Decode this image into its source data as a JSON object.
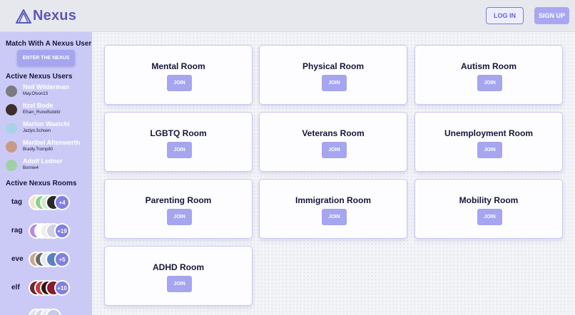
{
  "header": {
    "logo_text": "Nexus",
    "login_label": "LOG IN",
    "signup_label": "SIGN UP"
  },
  "sidebar": {
    "match_heading": "Match With A Nexus User",
    "enter_label": "ENTER THE NEXUS",
    "users_heading": "Active Nexus Users",
    "users": [
      {
        "name": "Neil Wilderman",
        "username": "May.Olson13",
        "avatar_color": "#7a7a80"
      },
      {
        "name": "Itzel Bode",
        "username": "Efrain_Runolfsdottir",
        "avatar_color": "#3e2e2a"
      },
      {
        "name": "Marlon Waelchi",
        "username": "Jazlyn.Schoen",
        "avatar_color": "#a9d2e6"
      },
      {
        "name": "Maribel Altenwerth",
        "username": "Bradly.Tromp80",
        "avatar_color": "#c89a86"
      },
      {
        "name": "Adolf Ledner",
        "username": "Bonnie4",
        "avatar_color": "#9fd0a6"
      }
    ],
    "rooms_heading": "Active Nexus Rooms",
    "rooms": [
      {
        "tag": "tag",
        "more": "+4",
        "colors": [
          "#f1e3c8",
          "#8ed08a",
          "#d6e8d0",
          "#2a2a2a"
        ]
      },
      {
        "tag": "rag",
        "more": "+19",
        "colors": [
          "#b88ae0",
          "#ffffff",
          "#eeeeee",
          "#d0d0e0"
        ]
      },
      {
        "tag": "eve",
        "more": "+5",
        "colors": [
          "#c9a98e",
          "#6a6a6a",
          "#e8e8ee",
          "#5a80c0"
        ]
      },
      {
        "tag": "elf",
        "more": "+10",
        "colors": [
          "#6a2a2a",
          "#c43a3a",
          "#2a1a1a",
          "#8a1a2a"
        ]
      },
      {
        "tag": "",
        "more": "",
        "colors": [
          "#e0e0f0",
          "#d0d6f0",
          "#eaeaf4",
          "#c8c8e8"
        ]
      }
    ]
  },
  "rooms": [
    {
      "title": "Mental Room",
      "join": "JOIN"
    },
    {
      "title": "Physical Room",
      "join": "JOIN"
    },
    {
      "title": "Autism Room",
      "join": "JOIN"
    },
    {
      "title": "LGBTQ Room",
      "join": "JOIN"
    },
    {
      "title": "Veterans Room",
      "join": "JOIN"
    },
    {
      "title": "Unemployment Room",
      "join": "JOIN"
    },
    {
      "title": "Parenting Room",
      "join": "JOIN"
    },
    {
      "title": "Immigration Room",
      "join": "JOIN"
    },
    {
      "title": "Mobility Room",
      "join": "JOIN"
    },
    {
      "title": "ADHD Room",
      "join": "JOIN"
    }
  ]
}
